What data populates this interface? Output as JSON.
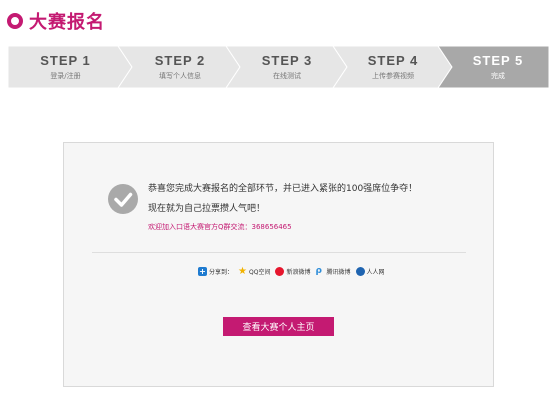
{
  "header": {
    "title": "大赛报名"
  },
  "colors": {
    "accent": "#c41a72",
    "step_inactive": "#e6e6e6",
    "step_active": "#a8a8a8"
  },
  "steps": [
    {
      "title": "STEP 1",
      "subtitle": "登录/注册"
    },
    {
      "title": "STEP 2",
      "subtitle": "填写个人信息"
    },
    {
      "title": "STEP 3",
      "subtitle": "在线测试"
    },
    {
      "title": "STEP 4",
      "subtitle": "上传参赛视频"
    },
    {
      "title": "STEP 5",
      "subtitle": "完成",
      "active": true
    }
  ],
  "panel": {
    "message_line1": "恭喜您完成大赛报名的全部环节，并已进入紧张的100强席位争夺！",
    "message_line2": "现在就为自己拉票攒人气吧！",
    "qq_group": "欢迎加入口语大赛官方Q群交流：368656465",
    "share": {
      "label": "分享到：",
      "items": [
        {
          "label": "QQ空间",
          "icon": "qzone-star-icon"
        },
        {
          "label": "新浪微博",
          "icon": "sina-weibo-icon"
        },
        {
          "label": "腾讯微博",
          "icon": "tencent-weibo-icon"
        },
        {
          "label": "人人网",
          "icon": "renren-icon"
        }
      ]
    },
    "button_label": "查看大赛个人主页"
  }
}
